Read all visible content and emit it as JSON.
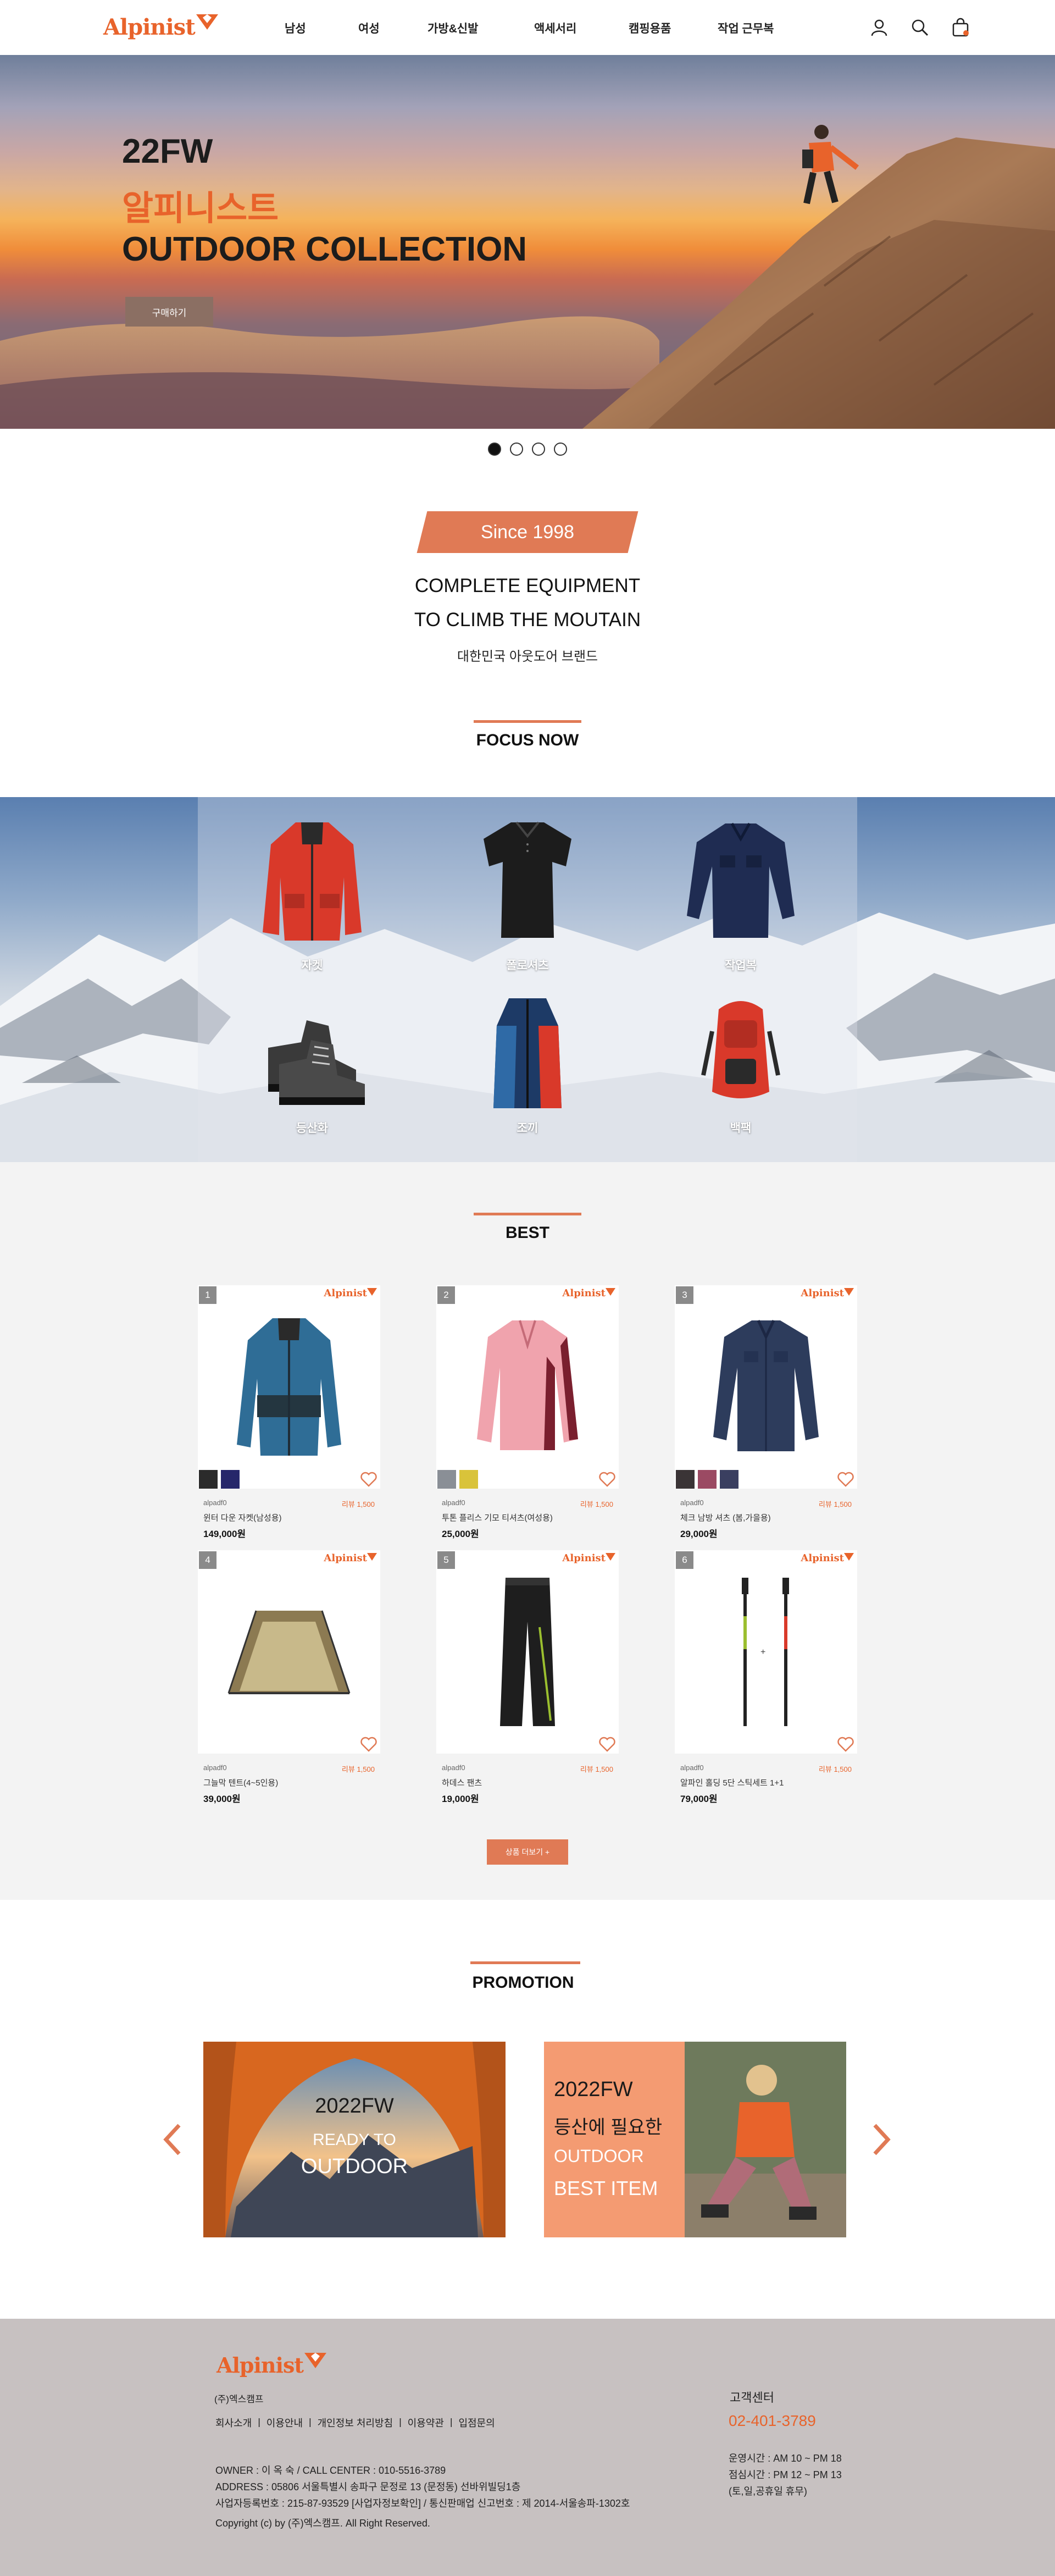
{
  "header": {
    "logo_text": "Alpinist",
    "nav": [
      "남성",
      "여성",
      "가방&신발",
      "액세서리",
      "캠핑용품",
      "작업 근무복"
    ],
    "icons": [
      "user-icon",
      "search-icon",
      "cart-icon"
    ]
  },
  "hero": {
    "line1": "22FW",
    "line2": "알피니스트",
    "line3": "OUTDOOR COLLECTION",
    "button": "구매하기",
    "slide_count": 4,
    "active_slide": 1
  },
  "intro": {
    "badge": "Since 1998",
    "title1": "COMPLETE EQUIPMENT",
    "title2": "TO CLIMB THE MOUTAIN",
    "subtitle": "대한민국 아웃도어 브랜드"
  },
  "focus": {
    "title": "FOCUS NOW",
    "categories": [
      "자켓",
      "폴로셔츠",
      "작업복",
      "등산화",
      "조끼",
      "백팩"
    ]
  },
  "best": {
    "title": "BEST",
    "products": [
      {
        "rank": "1",
        "brand": "alpadf0",
        "review": "리뷰 1,500",
        "name": "윈터 다운 자켓(남성용)",
        "price": "149,000원",
        "colors": [
          "#2b2b2b",
          "#26276a"
        ]
      },
      {
        "rank": "2",
        "brand": "alpadf0",
        "review": "리뷰 1,500",
        "name": "투톤 플리스 기모 티셔츠(여성용)",
        "price": "25,000원",
        "colors": [
          "#8a8f96",
          "#d9c33a"
        ]
      },
      {
        "rank": "3",
        "brand": "alpadf0",
        "review": "리뷰 1,500",
        "name": "체크 남방 셔츠 (봄,가을용)",
        "price": "29,000원",
        "colors": [
          "#3a3436",
          "#9b4a63",
          "#3a3f60"
        ]
      },
      {
        "rank": "4",
        "brand": "alpadf0",
        "review": "리뷰 1,500",
        "name": "그늘막 텐트(4~5인용)",
        "price": "39,000원",
        "colors": []
      },
      {
        "rank": "5",
        "brand": "alpadf0",
        "review": "리뷰 1,500",
        "name": "하데스 팬츠",
        "price": "19,000원",
        "colors": []
      },
      {
        "rank": "6",
        "brand": "alpadf0",
        "review": "리뷰 1,500",
        "name": "알파인 홀딩 5단 스틱세트 1+1",
        "price": "79,000원",
        "colors": []
      }
    ],
    "more_button": "상품 더보기 +"
  },
  "promotion": {
    "title": "PROMOTION",
    "banner1": {
      "line1": "2022FW",
      "line2": "READY TO",
      "line3": "OUTDOOR"
    },
    "banner2": {
      "line1": "2022FW",
      "line2": "등산에 필요한",
      "line3": "OUTDOOR",
      "line4": "BEST ITEM"
    }
  },
  "footer": {
    "logo_text": "Alpinist",
    "company": "(주)엑스캠프",
    "links": "회사소개 ㅣ 이용안내 ㅣ 개인정보 처리방침 ㅣ 이용약관 ㅣ 입점문의",
    "owner": "OWNER : 이 옥 숙 / CALL CENTER : 010-5516-3789",
    "address": "ADDRESS : 05806 서울특별시 송파구 문정로 13 (문정동) 선바위빌딩1층",
    "biz": "사업자등록번호 : 215-87-93529 [사업자정보확인] / 통신판매업 신고번호 : 제 2014-서울송파-1302호",
    "copyright": "Copyright (c) by (주)엑스캠프. All Right Reserved.",
    "cs_title": "고객센터",
    "cs_phone": "02-401-3789",
    "hours1": "운영시간 : AM 10 ~ PM 18",
    "hours2": "점심시간 : PM 12 ~ PM 13",
    "hours3": "(토,일,공휴일 휴무)"
  },
  "colors": {
    "accent": "#e8632b",
    "button": "#e07a55"
  }
}
